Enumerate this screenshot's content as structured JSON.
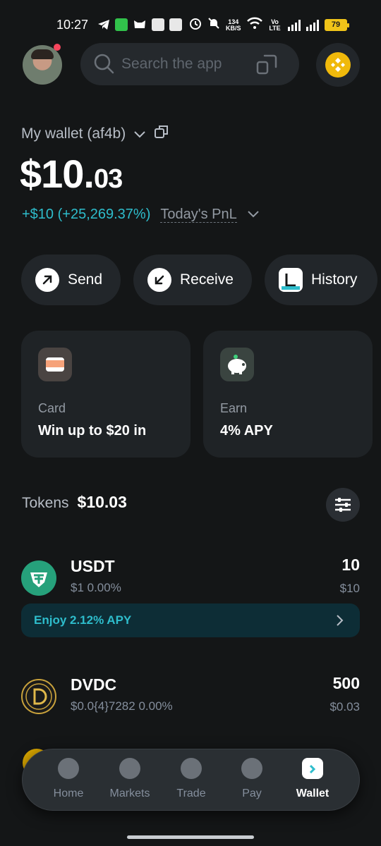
{
  "status_bar": {
    "time": "10:27",
    "net_speed_value": "134",
    "net_speed_unit": "KB/S",
    "volte": "Vo LTE",
    "battery": "79"
  },
  "header": {
    "search_placeholder": "Search the app"
  },
  "wallet": {
    "title": "My wallet (af4b)",
    "balance_main": "$10.",
    "balance_cents": "03",
    "pnl_value": "+$10 (+25,269.37%)",
    "pnl_label": "Today's PnL"
  },
  "actions": [
    {
      "label": "Send"
    },
    {
      "label": "Receive"
    },
    {
      "label": "History"
    }
  ],
  "promo_cards": [
    {
      "title": "Card",
      "desc": "Win up to $20 in"
    },
    {
      "title": "Earn",
      "desc": "4%  APY"
    }
  ],
  "tokens": {
    "label": "Tokens",
    "total": "$10.03",
    "items": [
      {
        "symbol": "USDT",
        "price": "$1 0.00%",
        "amount": "10",
        "usd": "$10"
      },
      {
        "symbol": "DVDC",
        "price": "$0.0{4}7282 0.00%",
        "amount": "500",
        "usd": "$0.03"
      }
    ],
    "usdt_promo": "Enjoy 2.12% APY"
  },
  "nav": {
    "items": [
      {
        "label": "Home"
      },
      {
        "label": "Markets"
      },
      {
        "label": "Trade"
      },
      {
        "label": "Pay"
      },
      {
        "label": "Wallet"
      }
    ],
    "active": "Wallet"
  },
  "colors": {
    "background": "#141617",
    "accent_teal": "#2ebdcc",
    "bnb_yellow": "#f0b90b",
    "usdt_green": "#26a17b"
  }
}
